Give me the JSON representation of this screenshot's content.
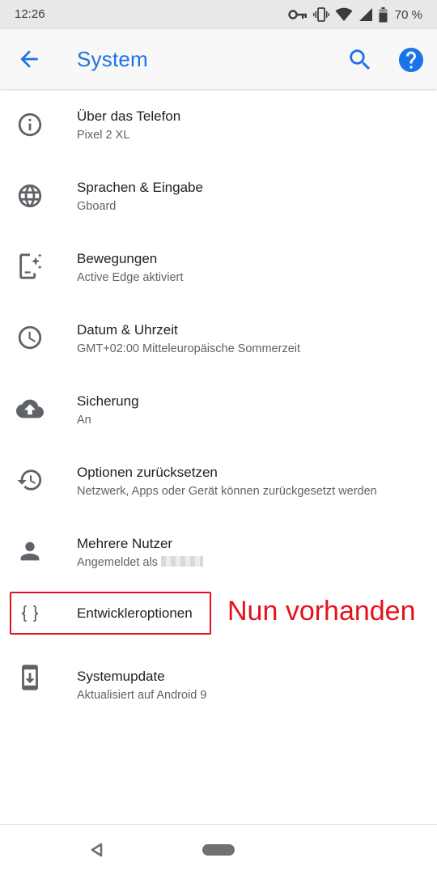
{
  "status_bar": {
    "time": "12:26",
    "battery_percent": "70 %",
    "icons": [
      "vpn-key-icon",
      "vibrate-icon",
      "wifi-icon",
      "cell-signal-icon",
      "battery-icon"
    ]
  },
  "app_bar": {
    "title": "System",
    "icons": [
      "back-arrow-icon",
      "search-icon",
      "help-icon"
    ]
  },
  "items": [
    {
      "label": "Über das Telefon",
      "sub": "Pixel 2 XL",
      "icon": "info-icon"
    },
    {
      "label": "Sprachen & Eingabe",
      "sub": "Gboard",
      "icon": "globe-icon"
    },
    {
      "label": "Bewegungen",
      "sub": "Active Edge aktiviert",
      "icon": "gestures-icon"
    },
    {
      "label": "Datum & Uhrzeit",
      "sub": "GMT+02:00 Mitteleuropäische Sommerzeit",
      "icon": "clock-icon"
    },
    {
      "label": "Sicherung",
      "sub": "An",
      "icon": "cloud-upload-icon"
    },
    {
      "label": "Optionen zurücksetzen",
      "sub": "Netzwerk, Apps oder Gerät können zurückgesetzt werden",
      "icon": "restore-icon"
    },
    {
      "label": "Mehrere Nutzer",
      "sub": "Angemeldet als",
      "icon": "person-icon"
    },
    {
      "label": "Entwickleroptionen",
      "sub": "",
      "icon": "code-braces-icon"
    },
    {
      "label": "Systemupdate",
      "sub": "Aktualisiert auf Android 9",
      "icon": "system-update-icon"
    }
  ],
  "annotation": {
    "text": "Nun vorhanden",
    "color": "#e5121b"
  },
  "colors": {
    "accent": "#1a73e8",
    "icon_gray": "#5f6368",
    "status_bar_bg": "#e8e8e8"
  },
  "nav_bar": {
    "icons": [
      "nav-back-icon",
      "nav-home-pill"
    ]
  }
}
